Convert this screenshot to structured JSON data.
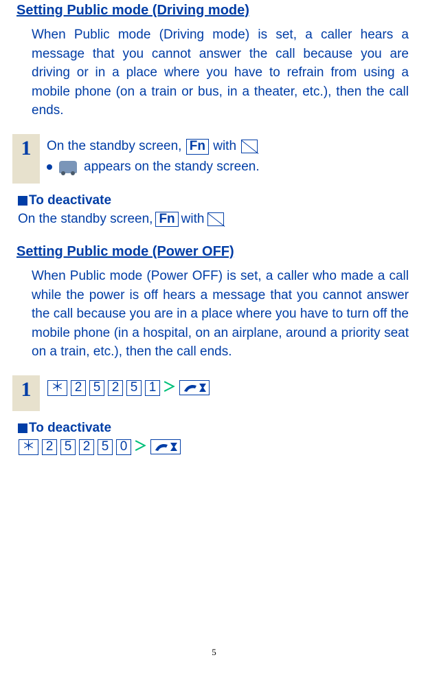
{
  "section1": {
    "title": " Setting Public mode (Driving mode)",
    "paragraph": "When Public mode (Driving mode) is set, a caller hears a message that you cannot answer the call because you are driving or in a place where you have to refrain from using a mobile phone (on a train or bus, in a theater, etc.), then the call ends.",
    "step1": {
      "num": "1",
      "line1_a": "On the standby screen, ",
      "fn": "Fn",
      "line1_b": " with ",
      "bullet_text": " appears on the standy screen."
    },
    "deactivate_heading": "To deactivate",
    "deactivate_a": "On the standby screen, ",
    "deactivate_fn": "Fn",
    "deactivate_b": " with "
  },
  "section2": {
    "title": "Setting Public mode (Power OFF)",
    "paragraph": "When Public mode (Power OFF) is set, a caller who made a call while the power is off hears a message that you cannot answer the call because you are in a place where you have to turn off the mobile phone (in a hospital, on an airplane, around a priority seat on a train, etc.), then the call ends.",
    "step1": {
      "num": "1",
      "keys": [
        "＊",
        "2",
        "5",
        "2",
        "5",
        "1"
      ],
      "gt": "＞"
    },
    "deactivate_heading": "To deactivate",
    "deactivate_keys": [
      "＊",
      "2",
      "5",
      "2",
      "5",
      "0"
    ],
    "deactivate_gt": "＞"
  },
  "page_number": "5"
}
